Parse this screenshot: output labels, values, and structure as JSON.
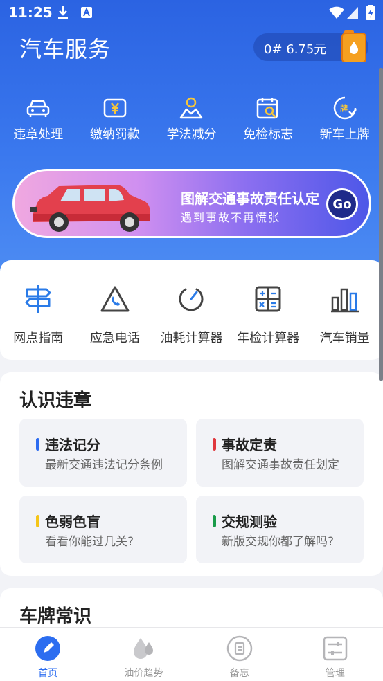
{
  "status_bar": {
    "time": "11:25"
  },
  "header": {
    "title": "汽车服务",
    "oil_price": "0# 6.75元"
  },
  "quick_services": [
    {
      "label": "违章处理",
      "icon": "car-front-icon"
    },
    {
      "label": "缴纳罚款",
      "icon": "yuan-card-icon"
    },
    {
      "label": "学法减分",
      "icon": "person-study-icon"
    },
    {
      "label": "免检标志",
      "icon": "calendar-search-icon"
    },
    {
      "label": "新车上牌",
      "icon": "plate-badge-icon"
    }
  ],
  "banner": {
    "title": "图解交通事故责任认定",
    "subtitle": "遇到事故不再慌张",
    "button": "Go"
  },
  "tools": [
    {
      "label": "网点指南",
      "icon": "signpost-icon"
    },
    {
      "label": "应急电话",
      "icon": "phone-triangle-icon"
    },
    {
      "label": "油耗计算器",
      "icon": "gauge-icon"
    },
    {
      "label": "年检计算器",
      "icon": "calculator-icon"
    },
    {
      "label": "汽车销量",
      "icon": "bar-chart-icon"
    }
  ],
  "violations": {
    "title": "认识违章",
    "tiles": [
      {
        "title": "违法记分",
        "subtitle": "最新交通违法记分条例",
        "color": "#2d6cf0"
      },
      {
        "title": "事故定责",
        "subtitle": "图解交通事故责任划定",
        "color": "#e0383e"
      },
      {
        "title": "色弱色盲",
        "subtitle": "看看你能过几关?",
        "color": "#f5c518"
      },
      {
        "title": "交规测验",
        "subtitle": "新版交规你都了解吗?",
        "color": "#1a9b4a"
      }
    ]
  },
  "plates": {
    "title": "车牌常识"
  },
  "tabs": [
    {
      "label": "首页",
      "icon": "home-pen-icon",
      "active": true
    },
    {
      "label": "油价趋势",
      "icon": "oil-drop-icon",
      "active": false
    },
    {
      "label": "备忘",
      "icon": "memo-icon",
      "active": false
    },
    {
      "label": "管理",
      "icon": "settings-sliders-icon",
      "active": false
    }
  ],
  "colors": {
    "primary": "#2c6df0",
    "header_top": "#2b63e2",
    "header_bottom": "#4d8cf3"
  }
}
